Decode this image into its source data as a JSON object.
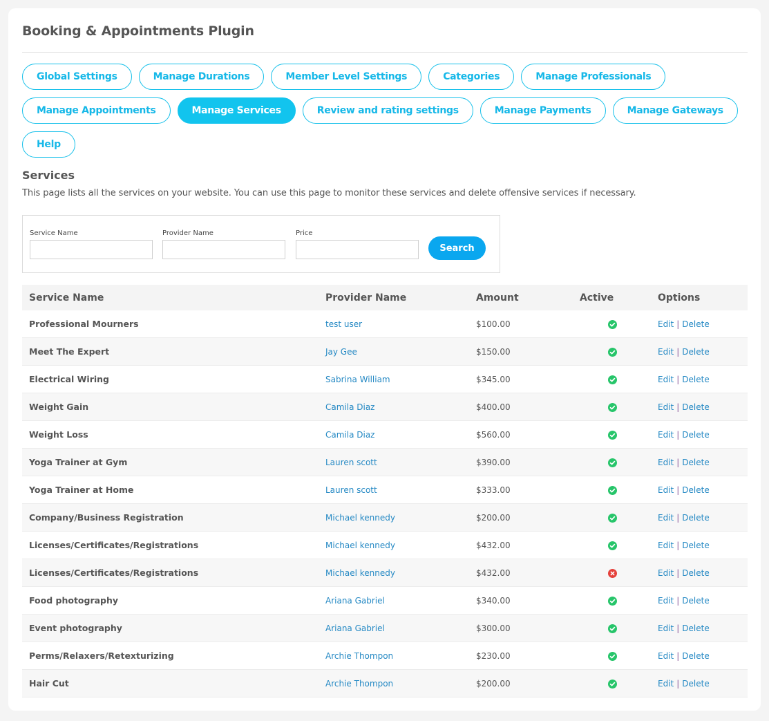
{
  "header": {
    "title": "Booking & Appointments Plugin"
  },
  "nav": {
    "rows": [
      [
        {
          "label": "Global Settings",
          "active": false
        },
        {
          "label": "Manage Durations",
          "active": false
        },
        {
          "label": "Member Level Settings",
          "active": false
        },
        {
          "label": "Categories",
          "active": false
        },
        {
          "label": "Manage Professionals",
          "active": false
        }
      ],
      [
        {
          "label": "Manage Appointments",
          "active": false
        },
        {
          "label": "Manage Services",
          "active": true
        },
        {
          "label": "Review and rating settings",
          "active": false
        },
        {
          "label": "Manage Payments",
          "active": false
        },
        {
          "label": "Manage Gateways",
          "active": false
        }
      ],
      [
        {
          "label": "Help",
          "active": false
        }
      ]
    ]
  },
  "section": {
    "title": "Services",
    "description": "This page lists all the services on your website. You can use this page to monitor these services and delete offensive services if necessary."
  },
  "search": {
    "fields": [
      {
        "label": "Service Name",
        "value": "",
        "placeholder": ""
      },
      {
        "label": "Provider Name",
        "value": "",
        "placeholder": ""
      },
      {
        "label": "Price",
        "value": "",
        "placeholder": ""
      }
    ],
    "button_label": "Search"
  },
  "table": {
    "columns": [
      "Service Name",
      "Provider Name",
      "Amount",
      "Active",
      "Options"
    ],
    "edit_label": "Edit",
    "delete_label": "Delete",
    "separator": "|",
    "rows": [
      {
        "service": "Professional Mourners",
        "provider": "test user",
        "amount": "$100.00",
        "active": true
      },
      {
        "service": "Meet The Expert",
        "provider": "Jay Gee",
        "amount": "$150.00",
        "active": true
      },
      {
        "service": "Electrical Wiring",
        "provider": "Sabrina William",
        "amount": "$345.00",
        "active": true
      },
      {
        "service": "Weight Gain",
        "provider": "Camila Diaz",
        "amount": "$400.00",
        "active": true
      },
      {
        "service": "Weight Loss",
        "provider": "Camila Diaz",
        "amount": "$560.00",
        "active": true
      },
      {
        "service": "Yoga Trainer at Gym",
        "provider": "Lauren scott",
        "amount": "$390.00",
        "active": true
      },
      {
        "service": "Yoga Trainer at Home",
        "provider": "Lauren scott",
        "amount": "$333.00",
        "active": true
      },
      {
        "service": "Company/Business Registration",
        "provider": "Michael kennedy",
        "amount": "$200.00",
        "active": true
      },
      {
        "service": "Licenses/Certificates/Registrations",
        "provider": "Michael kennedy",
        "amount": "$432.00",
        "active": true
      },
      {
        "service": "Licenses/Certificates/Registrations",
        "provider": "Michael kennedy",
        "amount": "$432.00",
        "active": false
      },
      {
        "service": "Food photography",
        "provider": "Ariana Gabriel",
        "amount": "$340.00",
        "active": true
      },
      {
        "service": "Event photography",
        "provider": "Ariana Gabriel",
        "amount": "$300.00",
        "active": true
      },
      {
        "service": "Perms/Relaxers/Retexturizing",
        "provider": "Archie Thompon",
        "amount": "$230.00",
        "active": true
      },
      {
        "service": "Hair Cut",
        "provider": "Archie Thompon",
        "amount": "$200.00",
        "active": true
      }
    ]
  },
  "colors": {
    "accent": "#12c4ee",
    "search_button": "#0aa7ef",
    "link": "#2589c4",
    "active_ok": "#27c56a",
    "active_no": "#e5413b"
  }
}
